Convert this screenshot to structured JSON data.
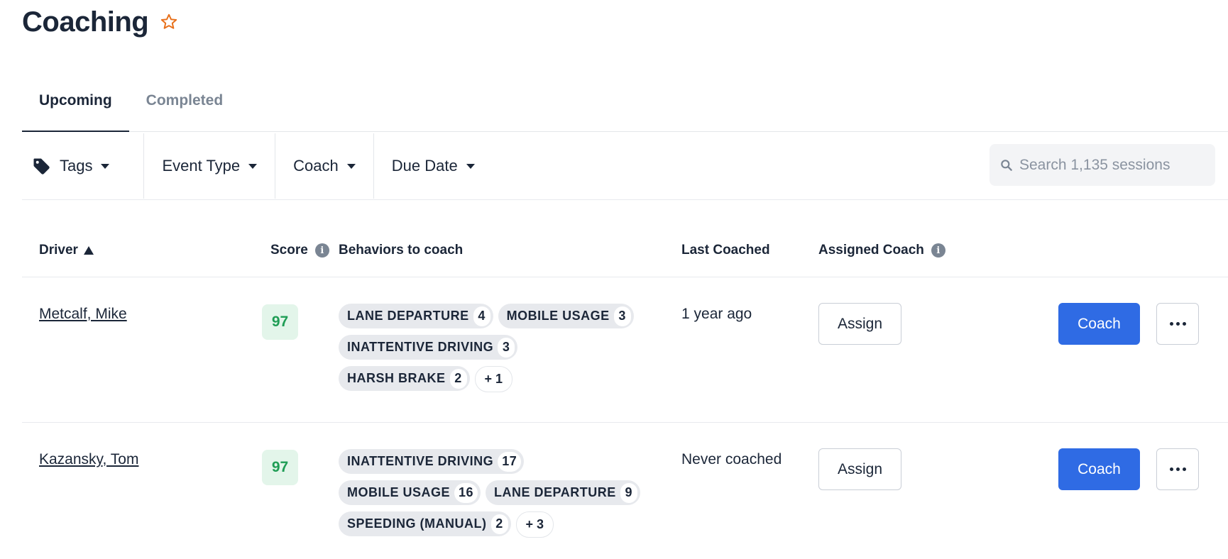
{
  "header": {
    "title": "Coaching",
    "star_icon": "star-outline-icon",
    "star_color": "#e8701a"
  },
  "tabs": [
    {
      "label": "Upcoming",
      "active": true
    },
    {
      "label": "Completed",
      "active": false
    }
  ],
  "filters": {
    "tags_label": "Tags",
    "event_type_label": "Event Type",
    "coach_label": "Coach",
    "due_date_label": "Due Date",
    "search_placeholder": "Search 1,135 sessions"
  },
  "table": {
    "columns": {
      "driver": "Driver",
      "score": "Score",
      "behaviors": "Behaviors to coach",
      "last_coached": "Last Coached",
      "assigned_coach": "Assigned Coach"
    },
    "sort": {
      "column": "driver",
      "direction": "ascending"
    },
    "rows": [
      {
        "driver": "Metcalf, Mike",
        "score": "97",
        "behavior_lines": [
          [
            {
              "label": "LANE DEPARTURE",
              "count": "4"
            },
            {
              "label": "MOBILE USAGE",
              "count": "3"
            }
          ],
          [
            {
              "label": "INATTENTIVE DRIVING",
              "count": "3"
            }
          ],
          [
            {
              "label": "HARSH BRAKE",
              "count": "2"
            }
          ]
        ],
        "more": "+ 1",
        "last_coached": "1 year ago",
        "assign_label": "Assign",
        "coach_label": "Coach"
      },
      {
        "driver": "Kazansky, Tom",
        "score": "97",
        "behavior_lines": [
          [
            {
              "label": "INATTENTIVE DRIVING",
              "count": "17"
            }
          ],
          [
            {
              "label": "MOBILE USAGE",
              "count": "16"
            },
            {
              "label": "LANE DEPARTURE",
              "count": "9"
            }
          ],
          [
            {
              "label": "SPEEDING (MANUAL)",
              "count": "2"
            }
          ]
        ],
        "more": "+ 3",
        "last_coached": "Never coached",
        "assign_label": "Assign",
        "coach_label": "Coach"
      }
    ]
  },
  "colors": {
    "primary_button": "#2f6be4",
    "score_bg": "#e3f5ea",
    "score_text": "#1f9d55"
  }
}
